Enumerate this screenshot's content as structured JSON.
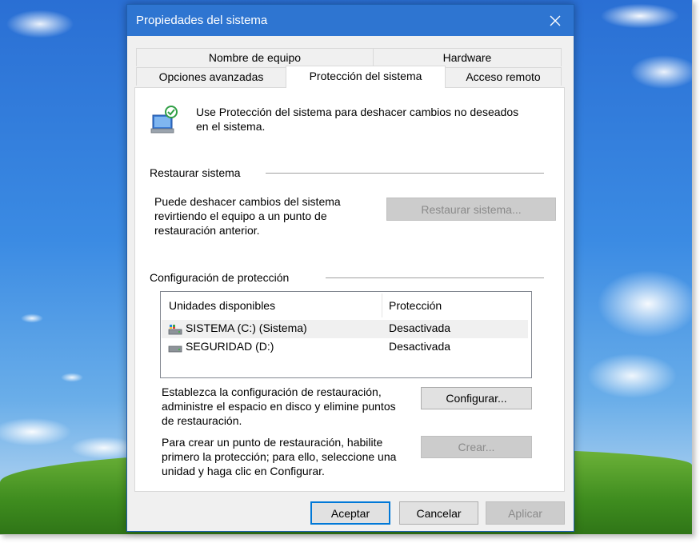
{
  "window": {
    "title": "Propiedades del sistema",
    "close_glyph": "✕"
  },
  "tabs": {
    "row1": [
      "Nombre de equipo",
      "Hardware"
    ],
    "row2": [
      "Opciones avanzadas",
      "Protección del sistema",
      "Acceso remoto"
    ],
    "active": "Protección del sistema"
  },
  "intro": {
    "text_line1": "Use Protección del sistema para deshacer cambios no deseados",
    "text_line2": "en el sistema.",
    "icon": "system-protection-icon"
  },
  "restore": {
    "heading": "Restaurar sistema",
    "desc_line1": "Puede deshacer cambios del sistema",
    "desc_line2": "revirtiendo el equipo a un punto de",
    "desc_line3": "restauración anterior.",
    "button": "Restaurar sistema..."
  },
  "protection": {
    "heading": "Configuración de protección",
    "columns": [
      "Unidades disponibles",
      "Protección"
    ],
    "drives": [
      {
        "name": "SISTEMA (C:) (Sistema)",
        "status": "Desactivada",
        "icon": "system-drive-icon",
        "selected": true
      },
      {
        "name": "SEGURIDAD (D:)",
        "status": "Desactivada",
        "icon": "drive-icon",
        "selected": false
      }
    ],
    "config_line1": "Establezca la configuración de restauración,",
    "config_line2": "administre el espacio en disco y elimine puntos",
    "config_line3": "de restauración.",
    "config_button": "Configurar...",
    "create_line1": "Para crear un punto de restauración, habilite",
    "create_line2": "primero la protección; para ello, seleccione una",
    "create_line3": "unidad y haga clic en Configurar.",
    "create_button": "Crear..."
  },
  "footer": {
    "ok": "Aceptar",
    "cancel": "Cancelar",
    "apply": "Aplicar"
  },
  "colors": {
    "titlebar": "#2e75d1",
    "accent": "#0078d7"
  }
}
